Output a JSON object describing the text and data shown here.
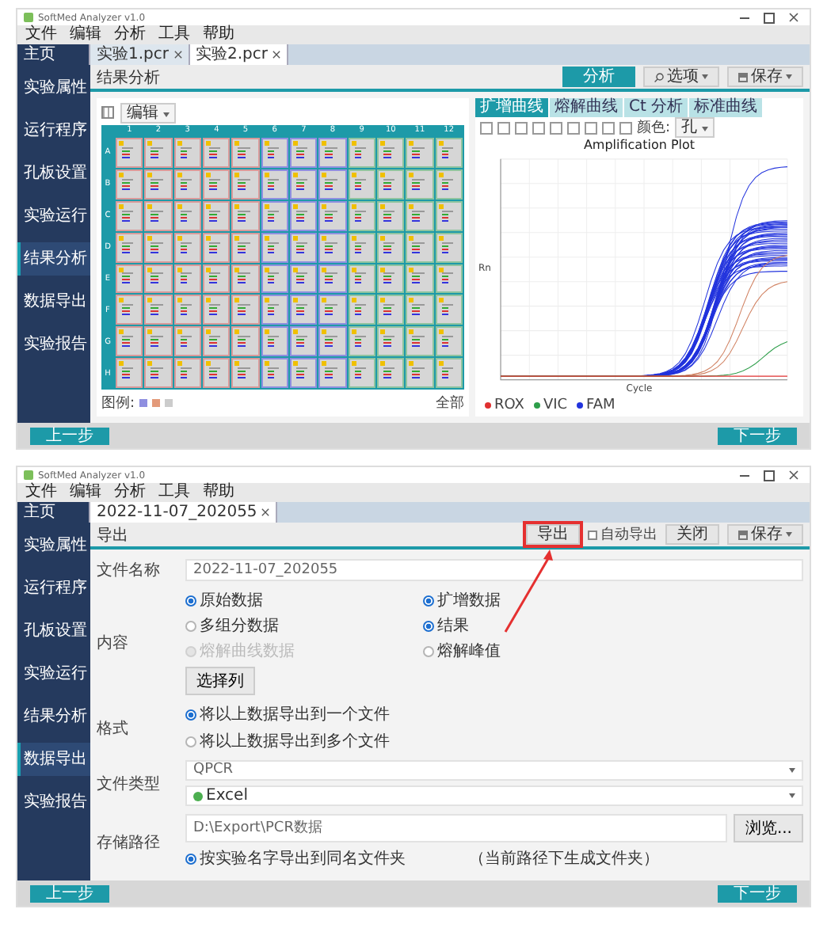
{
  "windows": [
    {
      "kind": "analysis",
      "title": "SoftMed Analyzer v1.0",
      "menu": [
        "文件",
        "编辑",
        "分析",
        "工具",
        "帮助"
      ],
      "tabs": [
        {
          "label": "主页",
          "kind": "home",
          "selected": false
        },
        {
          "label": "实验1.pcr",
          "kind": "doc",
          "selected": false
        },
        {
          "label": "实验2.pcr",
          "kind": "doc",
          "selected": true
        }
      ],
      "sidebar": [
        {
          "label": "实验属性",
          "selected": false
        },
        {
          "label": "运行程序",
          "selected": false
        },
        {
          "label": "孔板设置",
          "selected": false
        },
        {
          "label": "实验运行",
          "selected": false
        },
        {
          "label": "结果分析",
          "selected": true
        },
        {
          "label": "数据导出",
          "selected": false
        },
        {
          "label": "实验报告",
          "selected": false
        }
      ],
      "header": "结果分析",
      "actions": [
        {
          "label": "分析",
          "kind": "primary"
        },
        {
          "label": "选项",
          "kind": "search"
        },
        {
          "label": "保存",
          "kind": "save"
        }
      ],
      "plate": {
        "mode": "编辑",
        "columns": [
          {
            "label": "1",
            "color": "#d99a9a"
          },
          {
            "label": "2",
            "color": "#d99a9a"
          },
          {
            "label": "3",
            "color": "#d99a9a"
          },
          {
            "label": "4",
            "color": "#d99a9a"
          },
          {
            "label": "5",
            "color": "#d99a9a"
          },
          {
            "label": "6",
            "color": "#8f8fe0"
          },
          {
            "label": "7",
            "color": "#8f8fe0"
          },
          {
            "label": "8",
            "color": "#8f8fe0"
          },
          {
            "label": "9",
            "color": "#8fc49f"
          },
          {
            "label": "10",
            "color": "#8fc49f"
          },
          {
            "label": "11",
            "color": "#8fc49f"
          },
          {
            "label": "12",
            "color": "#8fc49f"
          }
        ],
        "rows": [
          "A",
          "B",
          "C",
          "D",
          "E",
          "F",
          "G",
          "H"
        ],
        "legend_label": "图例:",
        "view_label": "全部"
      },
      "chart_tabs": [
        {
          "label": "扩增曲线",
          "selected": true
        },
        {
          "label": "熔解曲线",
          "selected": false
        },
        {
          "label": "Ct 分析",
          "selected": false
        },
        {
          "label": "标准曲线",
          "selected": false
        }
      ],
      "chart_option": {
        "label": "颜色:",
        "value": "孔"
      },
      "chart": {
        "title": "Amplification Plot",
        "ylabel": "Rn",
        "xlabel": "Cycle",
        "legend": [
          {
            "label": "ROX",
            "color": "#e03030"
          },
          {
            "label": "VIC",
            "color": "#2e9e4a"
          },
          {
            "label": "FAM",
            "color": "#2233dd"
          }
        ]
      },
      "footer": {
        "back": "上一步",
        "next": "下一步"
      }
    },
    {
      "kind": "export",
      "title": "SoftMed Analyzer v1.0",
      "menu": [
        "文件",
        "编辑",
        "分析",
        "工具",
        "帮助"
      ],
      "tabs": [
        {
          "label": "主页",
          "kind": "home",
          "selected": false
        },
        {
          "label": "2022-11-07_202055",
          "kind": "doc",
          "selected": true
        }
      ],
      "sidebar": [
        {
          "label": "实验属性",
          "selected": false
        },
        {
          "label": "运行程序",
          "selected": false
        },
        {
          "label": "孔板设置",
          "selected": false
        },
        {
          "label": "实验运行",
          "selected": false
        },
        {
          "label": "结果分析",
          "selected": false
        },
        {
          "label": "数据导出",
          "selected": true
        },
        {
          "label": "实验报告",
          "selected": false
        }
      ],
      "header": "导出",
      "actions": [
        {
          "label": "导出",
          "kind": "plain",
          "highlighted": true
        },
        {
          "label": "自动导出",
          "kind": "check",
          "checked": false
        },
        {
          "label": "关闭",
          "kind": "plain",
          "highlighted": false
        },
        {
          "label": "保存",
          "kind": "save"
        }
      ],
      "form": {
        "filename_label": "文件名称",
        "filename": "2022-11-07_202055",
        "content_label": "内容",
        "content_options": [
          {
            "label": "原始数据",
            "checked": true,
            "disabled": false
          },
          {
            "label": "扩增数据",
            "checked": true,
            "disabled": false
          },
          {
            "label": "多组分数据",
            "checked": false,
            "disabled": false
          },
          {
            "label": "结果",
            "checked": true,
            "disabled": false
          },
          {
            "label": "熔解曲线数据",
            "checked": false,
            "disabled": true
          },
          {
            "label": "熔解峰值",
            "checked": false,
            "disabled": false
          }
        ],
        "columns_button": "选择列",
        "format_label": "格式",
        "format_options": [
          {
            "label": "将以上数据导出到一个文件",
            "selected": true
          },
          {
            "label": "将以上数据导出到多个文件",
            "selected": false
          }
        ],
        "type_label": "文件类型",
        "type_value": "QPCR",
        "subtype_value": "Excel",
        "path_label": "存储路径",
        "path_value": "D:\\Export\\PCR数据",
        "browse": "浏览...",
        "folder_option": {
          "label": "按实验名字导出到同名文件夹",
          "checked": true
        },
        "folder_note": "（当前路径下生成文件夹）"
      },
      "footer": {
        "back": "上一步",
        "next": "下一步"
      }
    }
  ]
}
